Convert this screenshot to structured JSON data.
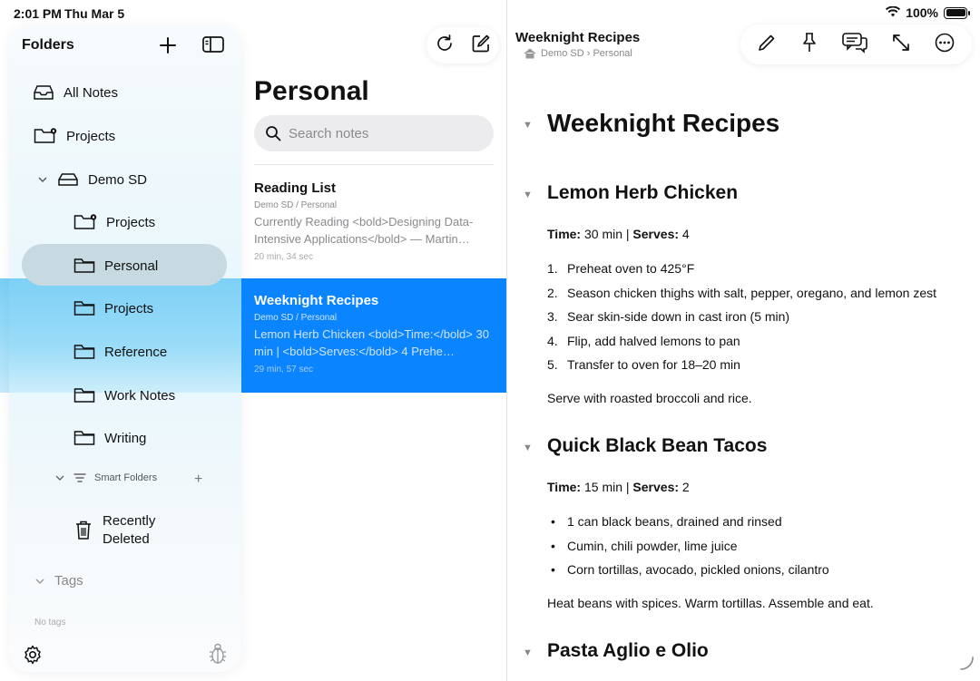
{
  "status": {
    "time": "2:01 PM",
    "date": "Thu Mar 5",
    "battery": "100%",
    "battery_level": 1.0
  },
  "sidebar": {
    "title": "Folders",
    "all_notes": "All Notes",
    "projects_root": "Projects",
    "demo_sd": "Demo SD",
    "folders": [
      {
        "label": "Projects",
        "icon": "folder-gear-icon"
      },
      {
        "label": "Personal",
        "icon": "folder-icon"
      },
      {
        "label": "Projects",
        "icon": "folder-icon"
      },
      {
        "label": "Reference",
        "icon": "folder-icon"
      },
      {
        "label": "Work Notes",
        "icon": "folder-icon"
      },
      {
        "label": "Writing",
        "icon": "folder-icon"
      }
    ],
    "smart_folders": "Smart Folders",
    "smart_plus": "+",
    "recently_deleted_line1": "Recently",
    "recently_deleted_line2": "Deleted",
    "tags": "Tags",
    "no_tags": "No tags"
  },
  "list": {
    "title": "Personal",
    "search_placeholder": "Search notes",
    "notes": [
      {
        "title": "Reading List",
        "path": "Demo SD / Personal",
        "preview": "Currently Reading <bold>Designing Data-Intensive Applications</bold> — Martin…",
        "time": "20 min, 34 sec"
      },
      {
        "title": "Weeknight Recipes",
        "path": "Demo SD / Personal",
        "preview": "Lemon Herb Chicken <bold>Time:</bold> 30 min | <bold>Serves:</bold> 4 Prehe…",
        "time": "29 min, 57 sec"
      }
    ]
  },
  "detail": {
    "small_title": "Weeknight Recipes",
    "breadcrumb": "Demo SD › Personal",
    "h1": "Weeknight Recipes",
    "sections": [
      {
        "heading": "Lemon Herb Chicken",
        "time_label": "Time:",
        "time_value": " 30 min | ",
        "serves_label": "Serves:",
        "serves_value": " 4",
        "steps": [
          "Preheat oven to 425°F",
          "Season chicken thighs with salt, pepper, oregano, and lemon zest",
          "Sear skin-side down in cast iron (5 min)",
          "Flip, add halved lemons to pan",
          "Transfer to oven for 18–20 min"
        ],
        "footer": "Serve with roasted broccoli and rice."
      },
      {
        "heading": "Quick Black Bean Tacos",
        "time_label": "Time:",
        "time_value": " 15 min | ",
        "serves_label": "Serves:",
        "serves_value": " 2",
        "bullets": [
          "1 can black beans, drained and rinsed",
          "Cumin, chili powder, lime juice",
          "Corn tortillas, avocado, pickled onions, cilantro"
        ],
        "footer": "Heat beans with spices. Warm tortillas. Assemble and eat."
      },
      {
        "heading": "Pasta Aglio e Olio"
      }
    ]
  },
  "colors": {
    "accent": "#0a84ff",
    "band": "#99dcf9",
    "selected_pill": "#c7d9e1"
  }
}
